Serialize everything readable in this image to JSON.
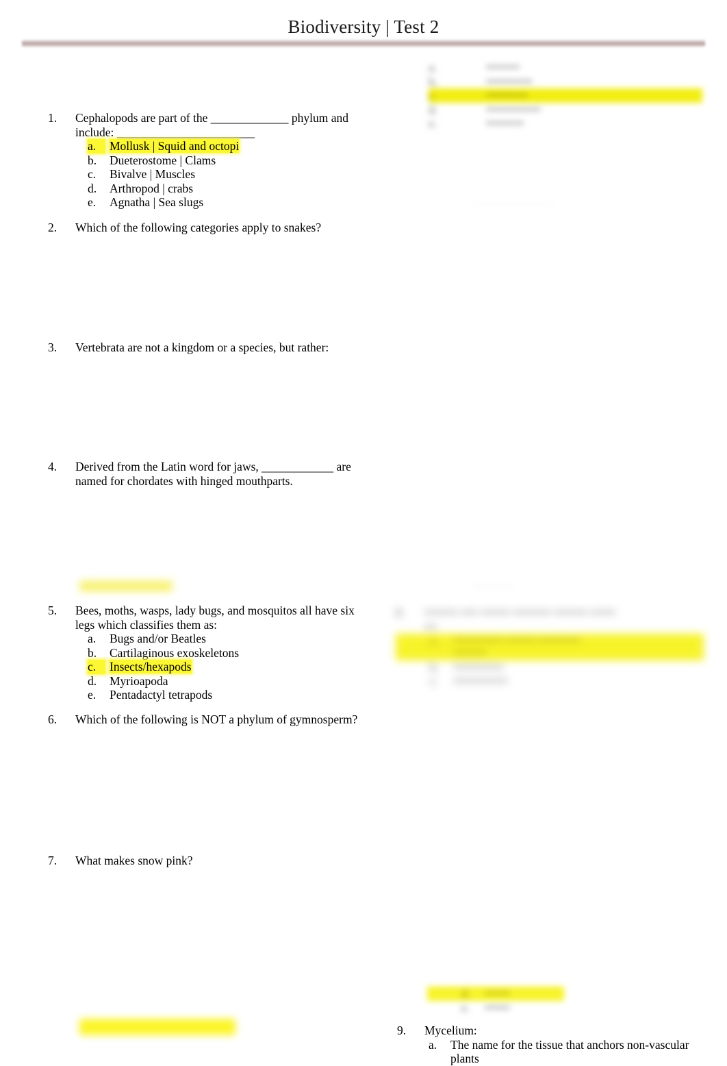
{
  "document": {
    "title": "Biodiversity | Test 2",
    "highlight_color": "#fbf733",
    "rule_color": "#b09696"
  },
  "questions": [
    {
      "number": "1.",
      "text": "Cephalopods  are part of the _____________ phylum and include: _______________________",
      "text_line1": "Cephalopods  are part of the _____________ phylum and",
      "text_line2": "include: _______________________",
      "options": [
        {
          "letter": "a.",
          "text": "Mollusk | Squid and octopi",
          "highlighted": true
        },
        {
          "letter": "b.",
          "text": "Dueterostome | Clams",
          "highlighted": false
        },
        {
          "letter": "c.",
          "text": "Bivalve | Muscles",
          "highlighted": false
        },
        {
          "letter": "d.",
          "text": "Arthropod | crabs",
          "highlighted": false
        },
        {
          "letter": "e.",
          "text": "Agnatha | Sea slugs",
          "highlighted": false
        }
      ]
    },
    {
      "number": "2.",
      "text": "Which of the following categories apply to snakes?",
      "options": []
    },
    {
      "number": "3.",
      "text": "Vertebrata are not a kingdom or a species, but rather:",
      "options": []
    },
    {
      "number": "4.",
      "text": "Derived from the Latin word for jaws, ____________ are named for chordates with hinged mouthparts.",
      "text_line1": "Derived from the Latin word for jaws, ____________ are",
      "text_line2": "named for chordates with hinged mouthparts.",
      "options": []
    },
    {
      "number": "5.",
      "text": "Bees, moths, wasps, lady bugs, and mosquitos all have six legs which classifies them as:",
      "text_line1": "Bees, moths, wasps, lady bugs, and mosquitos all have six",
      "text_line2": "legs which classifies them as:",
      "options": [
        {
          "letter": "a.",
          "text": "Bugs and/or Beatles",
          "highlighted": false
        },
        {
          "letter": "b.",
          "text": "Cartilaginous exoskeletons",
          "highlighted": false
        },
        {
          "letter": "c.",
          "text": "Insects/hexapods",
          "highlighted": true
        },
        {
          "letter": "d.",
          "text": "Myrioapoda",
          "highlighted": false
        },
        {
          "letter": "e.",
          "text": "Pentadactyl tetrapods",
          "highlighted": false,
          "clipped": true
        }
      ]
    },
    {
      "number": "6.",
      "text": "Which of the following is NOT a phylum of gymnosperm?",
      "options": []
    },
    {
      "number": "7.",
      "text": "What makes snow pink?",
      "options": []
    },
    {
      "number": "9.",
      "text": "Mycelium:",
      "options": [
        {
          "letter": "a.",
          "text": "The name for the tissue that anchors non-vascular plants",
          "highlighted": false,
          "text_line1": "The name for the tissue that anchors non-vascular",
          "text_line2": "plants"
        }
      ]
    }
  ],
  "redacted": {
    "note": "illegible blurred content",
    "top_right_options": {
      "lines": [
        "a.",
        "b.",
        "c.",
        "d.",
        "e."
      ],
      "highlighted_index": 2,
      "placeholder": "••••••••"
    },
    "question_8": {
      "number": "8.",
      "placeholder_text": "•••••••• •••• ••••••• ••••••••• •••••••• ••••••",
      "highlighted_option": "•••••••••••• ••••••• ••••••••••"
    }
  }
}
